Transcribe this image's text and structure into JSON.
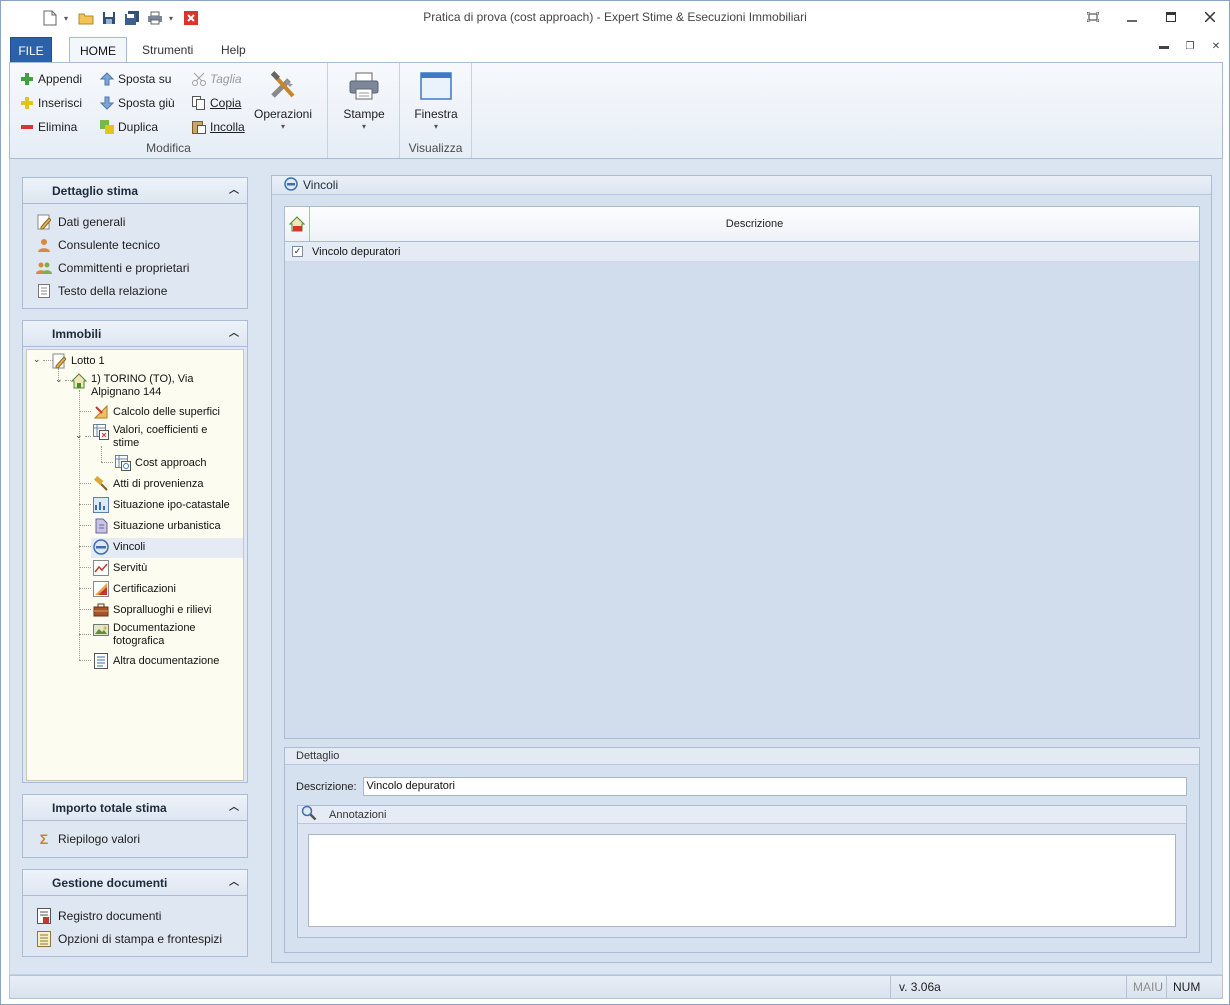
{
  "window": {
    "title": "Pratica di prova (cost approach) - Expert Stime & Esecuzioni Immobiliari"
  },
  "ribbon": {
    "tabs": [
      "FILE",
      "HOME",
      "Strumenti",
      "Help"
    ],
    "groups": {
      "modifica": {
        "label": "Modifica",
        "appendi": "Appendi",
        "inserisci": "Inserisci",
        "elimina": "Elimina",
        "sposta_su": "Sposta su",
        "sposta_giu": "Sposta giù",
        "duplica": "Duplica",
        "taglia": "Taglia",
        "copia": "Copia",
        "incolla": "Incolla",
        "operazioni": "Operazioni"
      },
      "stampe": {
        "label": "Stampe"
      },
      "visualizza": {
        "label": "Visualizza",
        "finestra": "Finestra"
      }
    }
  },
  "sidebar": {
    "dettaglio": {
      "title": "Dettaglio stima",
      "items": [
        "Dati generali",
        "Consulente tecnico",
        "Committenti e proprietari",
        "Testo della relazione"
      ]
    },
    "immobili": {
      "title": "Immobili",
      "tree": {
        "lotto": "Lotto 1",
        "immobile": "1) TORINO (TO), Via Alpignano 144",
        "calcolo": "Calcolo delle superfici",
        "valori": "Valori, coefficienti e stime",
        "cost": "Cost approach",
        "atti": "Atti di provenienza",
        "ipo": "Situazione ipo-catastale",
        "urbanistica": "Situazione urbanistica",
        "vincoli": "Vincoli",
        "servitu": "Servitù",
        "certificazioni": "Certificazioni",
        "sopralluoghi": "Sopralluoghi e rilievi",
        "documentazione": "Documentazione fotografica",
        "altra": "Altra documentazione"
      }
    },
    "importo": {
      "title": "Importo totale stima",
      "items": [
        "Riepilogo valori"
      ]
    },
    "gestione": {
      "title": "Gestione documenti",
      "items": [
        "Registro documenti",
        "Opzioni di stampa e frontespizi"
      ]
    }
  },
  "main": {
    "title": "Vincoli",
    "grid": {
      "column": "Descrizione",
      "rows": [
        {
          "checked": true,
          "descrizione": "Vincolo depuratori"
        }
      ]
    },
    "dettaglio": {
      "title": "Dettaglio",
      "descrizione_label": "Descrizione:",
      "descrizione_value": "Vincolo depuratori",
      "annotazioni_label": "Annotazioni"
    }
  },
  "statusbar": {
    "version": "v. 3.06a",
    "maiu": "MAIU",
    "num": "NUM"
  },
  "colors": {
    "accent": "#2b61a9",
    "workspace": "#dbe5f1",
    "close_red": "#c42b1c"
  }
}
